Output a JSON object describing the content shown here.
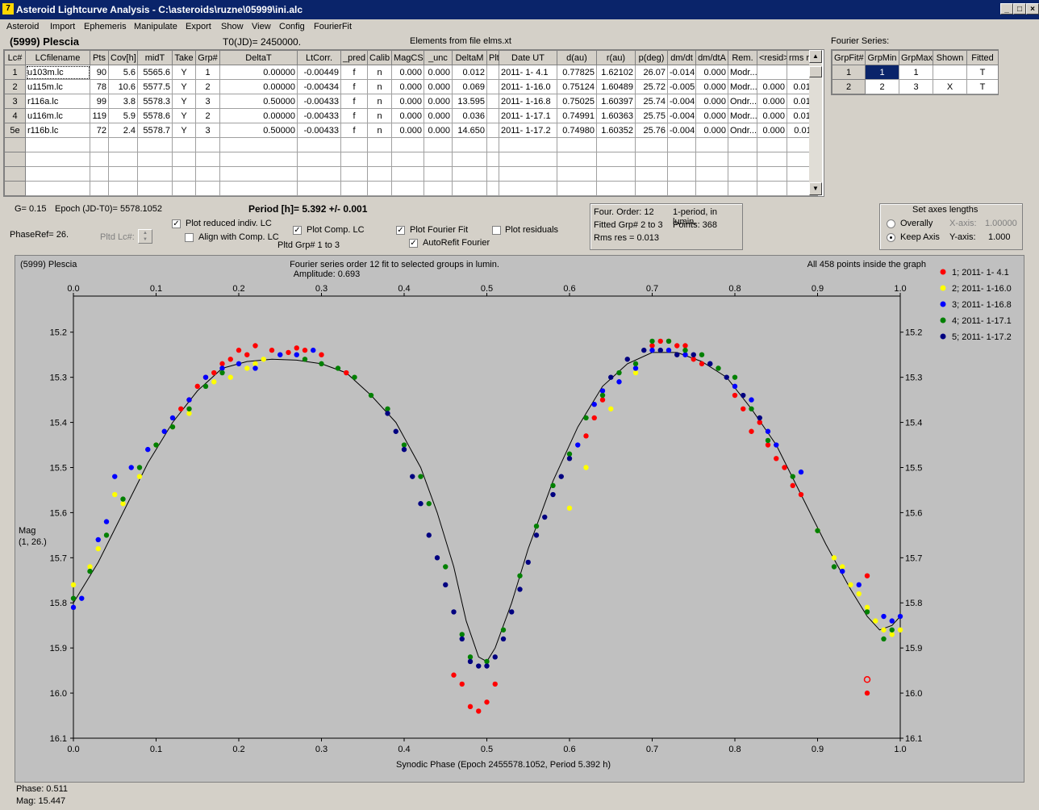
{
  "window": {
    "title": "Asteroid Lightcurve Analysis - C:\\asteroids\\ruzne\\05999\\ini.alc",
    "icon": "7"
  },
  "menu": [
    "Asteroid",
    "Import",
    "Ephemeris",
    "Manipulate",
    "Export",
    "Show",
    "View",
    "Config",
    "FourierFit"
  ],
  "header": {
    "asteroid": "(5999) Plescia",
    "t0": "T0(JD)= 2450000.",
    "elements": "Elements from file elms.xt",
    "fourier_title": "Fourier Series:"
  },
  "lc_table": {
    "columns": [
      "Lc#",
      "LCfilename",
      "Pts",
      "Cov[h]",
      "midT",
      "Take",
      "Grp#",
      "DeltaT",
      "LtCorr.",
      "_pred",
      "Calib",
      "MagCS",
      "_unc",
      "DeltaM",
      "Plt",
      "Date UT",
      "d(au)",
      "r(au)",
      "p(deg)",
      "dm/dt",
      "dm/dtA",
      "Rem.",
      "<resid>",
      "rms res"
    ],
    "rows": [
      [
        "1",
        "u103m.lc",
        "90",
        "5.6",
        "5565.6",
        "Y",
        "1",
        "0.00000",
        "-0.00449",
        "f",
        "n",
        "0.000",
        "0.000",
        "0.012",
        "",
        "2011- 1- 4.1",
        "0.77825",
        "1.62102",
        "26.07",
        "-0.014",
        "0.000",
        "Modr...",
        "",
        ""
      ],
      [
        "2",
        "u115m.lc",
        "78",
        "10.6",
        "5577.5",
        "Y",
        "2",
        "0.00000",
        "-0.00434",
        "f",
        "n",
        "0.000",
        "0.000",
        "0.069",
        "",
        "2011- 1-16.0",
        "0.75124",
        "1.60489",
        "25.72",
        "-0.005",
        "0.000",
        "Modr...",
        "0.000",
        "0.014"
      ],
      [
        "3",
        "r116a.lc",
        "99",
        "3.8",
        "5578.3",
        "Y",
        "3",
        "0.50000",
        "-0.00433",
        "f",
        "n",
        "0.000",
        "0.000",
        "13.595",
        "",
        "2011- 1-16.8",
        "0.75025",
        "1.60397",
        "25.74",
        "-0.004",
        "0.000",
        "Ondr...",
        "0.000",
        "0.013"
      ],
      [
        "4",
        "u116m.lc",
        "119",
        "5.9",
        "5578.6",
        "Y",
        "2",
        "0.00000",
        "-0.00433",
        "f",
        "n",
        "0.000",
        "0.000",
        "0.036",
        "",
        "2011- 1-17.1",
        "0.74991",
        "1.60363",
        "25.75",
        "-0.004",
        "0.000",
        "Modr...",
        "0.000",
        "0.012"
      ],
      [
        "5e",
        "r116b.lc",
        "72",
        "2.4",
        "5578.7",
        "Y",
        "3",
        "0.50000",
        "-0.00433",
        "f",
        "n",
        "0.000",
        "0.000",
        "14.650",
        "",
        "2011- 1-17.2",
        "0.74980",
        "1.60352",
        "25.76",
        "-0.004",
        "0.000",
        "Ondr...",
        "0.000",
        "0.011"
      ]
    ]
  },
  "fourier_table": {
    "columns": [
      "GrpFit#",
      "GrpMin",
      "GrpMax",
      "Shown",
      "Fitted"
    ],
    "rows": [
      [
        "1",
        "1",
        "1",
        "",
        "T"
      ],
      [
        "2",
        "2",
        "3",
        "X",
        "T"
      ]
    ]
  },
  "controls": {
    "g": "G= 0.15",
    "epoch": "Epoch (JD-T0)= 5578.1052",
    "period": "Period [h]= 5.392 +/- 0.001",
    "phaseref": "PhaseRef= 26.",
    "pltd_lc": "Pltd Lc#:",
    "plot_reduced": "Plot reduced indiv. LC",
    "align": "Align with Comp. LC",
    "plot_comp": "Plot Comp. LC",
    "pltd_grp": "Pltd Grp#  1   to   3",
    "plot_fourier": "Plot Fourier Fit",
    "autorefit": "AutoRefit Fourier",
    "plot_residuals": "Plot residuals",
    "info1": "Four. Order: 12",
    "info2": "1-period, in lumin.",
    "info3": "Fitted Grp# 2 to 3",
    "info4": "Points: 368",
    "info5": "Rms res     = 0.013",
    "axes_title": "Set axes lengths",
    "overally": "Overally",
    "keepaxis": "Keep Axis",
    "xaxis_label": "X-axis:",
    "xaxis_val": "1.00000",
    "yaxis_label": "Y-axis:",
    "yaxis_val": "1.000"
  },
  "status": {
    "phase": "Phase:  0.511",
    "mag": "Mag:    15.447"
  },
  "chart_data": {
    "type": "scatter",
    "object": "(5999) Plescia",
    "title": "Fourier series order 12 fit to selected groups in lumin.",
    "subtitle": "Amplitude: 0.693",
    "note": "All 458 points inside the graph",
    "xlabel": "Synodic Phase (Epoch 2455578.1052, Period 5.392 h)",
    "ylabel": "Mag",
    "ylabel2": "(1, 26.)",
    "xlim": [
      0.0,
      1.0
    ],
    "ylim": [
      16.1,
      15.12
    ],
    "xticks": [
      "0.0",
      "0.1",
      "0.2",
      "0.3",
      "0.4",
      "0.5",
      "0.6",
      "0.7",
      "0.8",
      "0.9",
      "1.0"
    ],
    "yticks": [
      "15.2",
      "15.3",
      "15.4",
      "15.5",
      "15.6",
      "15.7",
      "15.8",
      "15.9",
      "16.0",
      "16.1"
    ],
    "fit_curve": [
      [
        0.0,
        15.8
      ],
      [
        0.03,
        15.71
      ],
      [
        0.06,
        15.6
      ],
      [
        0.09,
        15.49
      ],
      [
        0.12,
        15.4
      ],
      [
        0.15,
        15.33
      ],
      [
        0.18,
        15.28
      ],
      [
        0.21,
        15.265
      ],
      [
        0.24,
        15.26
      ],
      [
        0.27,
        15.262
      ],
      [
        0.3,
        15.27
      ],
      [
        0.33,
        15.29
      ],
      [
        0.36,
        15.34
      ],
      [
        0.39,
        15.4
      ],
      [
        0.42,
        15.5
      ],
      [
        0.44,
        15.6
      ],
      [
        0.46,
        15.72
      ],
      [
        0.475,
        15.84
      ],
      [
        0.49,
        15.92
      ],
      [
        0.5,
        15.93
      ],
      [
        0.51,
        15.9
      ],
      [
        0.53,
        15.8
      ],
      [
        0.55,
        15.68
      ],
      [
        0.58,
        15.53
      ],
      [
        0.61,
        15.41
      ],
      [
        0.64,
        15.32
      ],
      [
        0.67,
        15.27
      ],
      [
        0.7,
        15.245
      ],
      [
        0.73,
        15.245
      ],
      [
        0.76,
        15.265
      ],
      [
        0.79,
        15.3
      ],
      [
        0.82,
        15.37
      ],
      [
        0.85,
        15.45
      ],
      [
        0.88,
        15.56
      ],
      [
        0.91,
        15.67
      ],
      [
        0.94,
        15.77
      ],
      [
        0.96,
        15.83
      ],
      [
        0.975,
        15.86
      ],
      [
        0.99,
        15.85
      ],
      [
        1.0,
        15.83
      ]
    ],
    "series": [
      {
        "name": "1; 2011- 1- 4.1",
        "color": "#ff0000",
        "points": [
          [
            0.13,
            15.37
          ],
          [
            0.14,
            15.35
          ],
          [
            0.15,
            15.32
          ],
          [
            0.16,
            15.3
          ],
          [
            0.17,
            15.29
          ],
          [
            0.18,
            15.27
          ],
          [
            0.19,
            15.26
          ],
          [
            0.2,
            15.24
          ],
          [
            0.21,
            15.25
          ],
          [
            0.22,
            15.23
          ],
          [
            0.24,
            15.24
          ],
          [
            0.26,
            15.245
          ],
          [
            0.27,
            15.235
          ],
          [
            0.28,
            15.24
          ],
          [
            0.3,
            15.25
          ],
          [
            0.33,
            15.29
          ],
          [
            0.46,
            15.96
          ],
          [
            0.47,
            15.98
          ],
          [
            0.48,
            16.03
          ],
          [
            0.49,
            16.04
          ],
          [
            0.5,
            16.02
          ],
          [
            0.51,
            15.98
          ],
          [
            0.62,
            15.43
          ],
          [
            0.63,
            15.39
          ],
          [
            0.64,
            15.35
          ],
          [
            0.7,
            15.23
          ],
          [
            0.71,
            15.22
          ],
          [
            0.72,
            15.22
          ],
          [
            0.73,
            15.23
          ],
          [
            0.74,
            15.23
          ],
          [
            0.75,
            15.26
          ],
          [
            0.76,
            15.27
          ],
          [
            0.8,
            15.34
          ],
          [
            0.81,
            15.37
          ],
          [
            0.82,
            15.42
          ],
          [
            0.83,
            15.4
          ],
          [
            0.84,
            15.45
          ],
          [
            0.85,
            15.48
          ],
          [
            0.86,
            15.5
          ],
          [
            0.87,
            15.54
          ],
          [
            0.88,
            15.56
          ],
          [
            0.96,
            15.74
          ],
          [
            0.96,
            16.0
          ]
        ]
      },
      {
        "name": "2; 2011- 1-16.0",
        "color": "#ffff00",
        "points": [
          [
            0.0,
            15.76
          ],
          [
            0.02,
            15.72
          ],
          [
            0.03,
            15.68
          ],
          [
            0.05,
            15.56
          ],
          [
            0.06,
            15.58
          ],
          [
            0.08,
            15.52
          ],
          [
            0.1,
            15.45
          ],
          [
            0.12,
            15.41
          ],
          [
            0.14,
            15.38
          ],
          [
            0.17,
            15.31
          ],
          [
            0.19,
            15.3
          ],
          [
            0.21,
            15.28
          ],
          [
            0.22,
            15.27
          ],
          [
            0.23,
            15.26
          ],
          [
            0.6,
            15.59
          ],
          [
            0.62,
            15.5
          ],
          [
            0.65,
            15.37
          ],
          [
            0.68,
            15.29
          ],
          [
            0.9,
            15.64
          ],
          [
            0.92,
            15.7
          ],
          [
            0.93,
            15.72
          ],
          [
            0.94,
            15.76
          ],
          [
            0.95,
            15.78
          ],
          [
            0.96,
            15.81
          ],
          [
            0.97,
            15.84
          ],
          [
            0.98,
            15.86
          ],
          [
            0.99,
            15.87
          ],
          [
            1.0,
            15.86
          ]
        ]
      },
      {
        "name": "3; 2011- 1-16.8",
        "color": "#0000ff",
        "points": [
          [
            0.0,
            15.81
          ],
          [
            0.01,
            15.79
          ],
          [
            0.03,
            15.66
          ],
          [
            0.04,
            15.62
          ],
          [
            0.05,
            15.52
          ],
          [
            0.07,
            15.5
          ],
          [
            0.09,
            15.46
          ],
          [
            0.11,
            15.42
          ],
          [
            0.12,
            15.39
          ],
          [
            0.14,
            15.35
          ],
          [
            0.16,
            15.3
          ],
          [
            0.18,
            15.28
          ],
          [
            0.2,
            15.27
          ],
          [
            0.22,
            15.28
          ],
          [
            0.25,
            15.25
          ],
          [
            0.27,
            15.25
          ],
          [
            0.29,
            15.24
          ],
          [
            0.61,
            15.45
          ],
          [
            0.63,
            15.36
          ],
          [
            0.64,
            15.33
          ],
          [
            0.66,
            15.31
          ],
          [
            0.68,
            15.28
          ],
          [
            0.7,
            15.24
          ],
          [
            0.72,
            15.24
          ],
          [
            0.74,
            15.25
          ],
          [
            0.77,
            15.27
          ],
          [
            0.8,
            15.32
          ],
          [
            0.82,
            15.35
          ],
          [
            0.84,
            15.42
          ],
          [
            0.85,
            15.45
          ],
          [
            0.88,
            15.51
          ],
          [
            0.93,
            15.73
          ],
          [
            0.95,
            15.76
          ],
          [
            0.98,
            15.83
          ],
          [
            0.99,
            15.84
          ],
          [
            1.0,
            15.83
          ]
        ]
      },
      {
        "name": "4; 2011- 1-17.1",
        "color": "#008000",
        "points": [
          [
            0.0,
            15.79
          ],
          [
            0.02,
            15.73
          ],
          [
            0.04,
            15.65
          ],
          [
            0.06,
            15.57
          ],
          [
            0.08,
            15.5
          ],
          [
            0.1,
            15.45
          ],
          [
            0.12,
            15.41
          ],
          [
            0.14,
            15.37
          ],
          [
            0.16,
            15.32
          ],
          [
            0.18,
            15.29
          ],
          [
            0.28,
            15.26
          ],
          [
            0.3,
            15.27
          ],
          [
            0.32,
            15.28
          ],
          [
            0.34,
            15.3
          ],
          [
            0.36,
            15.34
          ],
          [
            0.38,
            15.37
          ],
          [
            0.4,
            15.45
          ],
          [
            0.42,
            15.52
          ],
          [
            0.43,
            15.58
          ],
          [
            0.45,
            15.72
          ],
          [
            0.47,
            15.87
          ],
          [
            0.48,
            15.92
          ],
          [
            0.5,
            15.93
          ],
          [
            0.52,
            15.86
          ],
          [
            0.54,
            15.74
          ],
          [
            0.56,
            15.63
          ],
          [
            0.58,
            15.54
          ],
          [
            0.6,
            15.47
          ],
          [
            0.62,
            15.39
          ],
          [
            0.64,
            15.34
          ],
          [
            0.66,
            15.29
          ],
          [
            0.68,
            15.27
          ],
          [
            0.7,
            15.22
          ],
          [
            0.72,
            15.22
          ],
          [
            0.74,
            15.24
          ],
          [
            0.76,
            15.25
          ],
          [
            0.78,
            15.28
          ],
          [
            0.8,
            15.3
          ],
          [
            0.82,
            15.37
          ],
          [
            0.84,
            15.44
          ],
          [
            0.87,
            15.52
          ],
          [
            0.9,
            15.64
          ],
          [
            0.92,
            15.72
          ],
          [
            0.96,
            15.82
          ],
          [
            0.98,
            15.88
          ],
          [
            0.99,
            15.86
          ]
        ]
      },
      {
        "name": "5; 2011- 1-17.2",
        "color": "#000080",
        "points": [
          [
            0.38,
            15.38
          ],
          [
            0.39,
            15.42
          ],
          [
            0.4,
            15.46
          ],
          [
            0.41,
            15.52
          ],
          [
            0.42,
            15.58
          ],
          [
            0.43,
            15.65
          ],
          [
            0.44,
            15.7
          ],
          [
            0.45,
            15.76
          ],
          [
            0.46,
            15.82
          ],
          [
            0.47,
            15.88
          ],
          [
            0.48,
            15.93
          ],
          [
            0.49,
            15.94
          ],
          [
            0.5,
            15.94
          ],
          [
            0.51,
            15.92
          ],
          [
            0.52,
            15.88
          ],
          [
            0.53,
            15.82
          ],
          [
            0.54,
            15.77
          ],
          [
            0.55,
            15.71
          ],
          [
            0.56,
            15.65
          ],
          [
            0.57,
            15.61
          ],
          [
            0.58,
            15.56
          ],
          [
            0.59,
            15.52
          ],
          [
            0.6,
            15.48
          ],
          [
            0.65,
            15.3
          ],
          [
            0.67,
            15.26
          ],
          [
            0.69,
            15.24
          ],
          [
            0.71,
            15.24
          ],
          [
            0.73,
            15.25
          ],
          [
            0.75,
            15.25
          ],
          [
            0.77,
            15.27
          ],
          [
            0.79,
            15.3
          ],
          [
            0.81,
            15.34
          ],
          [
            0.83,
            15.39
          ]
        ]
      }
    ]
  }
}
